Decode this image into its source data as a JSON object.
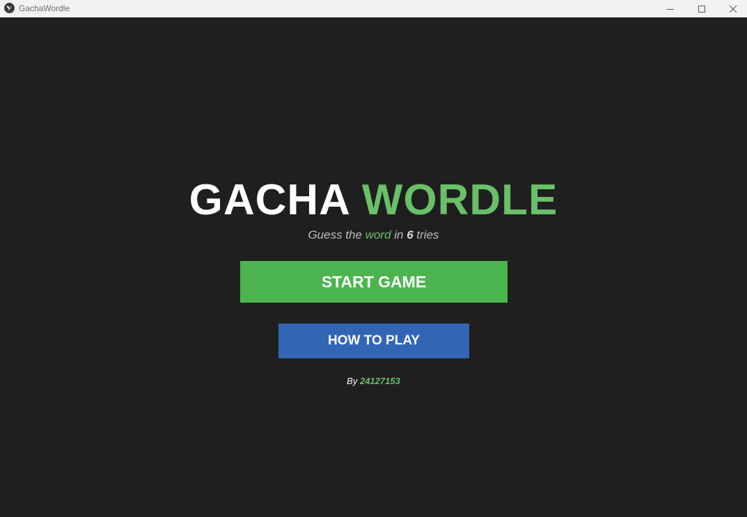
{
  "window": {
    "title": "GachaWordle"
  },
  "title": {
    "part1": "GACHA",
    "part2": "WORDLE"
  },
  "subtitle": {
    "pre": "Guess the ",
    "word": "word",
    "mid": " in ",
    "count": "6",
    "post": " tries"
  },
  "buttons": {
    "start_label": "START GAME",
    "how_to_label": "HOW TO PLAY"
  },
  "credit": {
    "by_label": "By ",
    "author_id": "24127153"
  },
  "colors": {
    "background": "#1f1f1f",
    "accent_green": "#6abf69",
    "start_button": "#4cb54f",
    "how_to_button": "#3266b5",
    "titlebar": "#f2f2f2"
  },
  "icons": {
    "app": "kivy-icon",
    "minimize": "minimize-icon",
    "maximize": "maximize-icon",
    "close": "close-icon"
  }
}
